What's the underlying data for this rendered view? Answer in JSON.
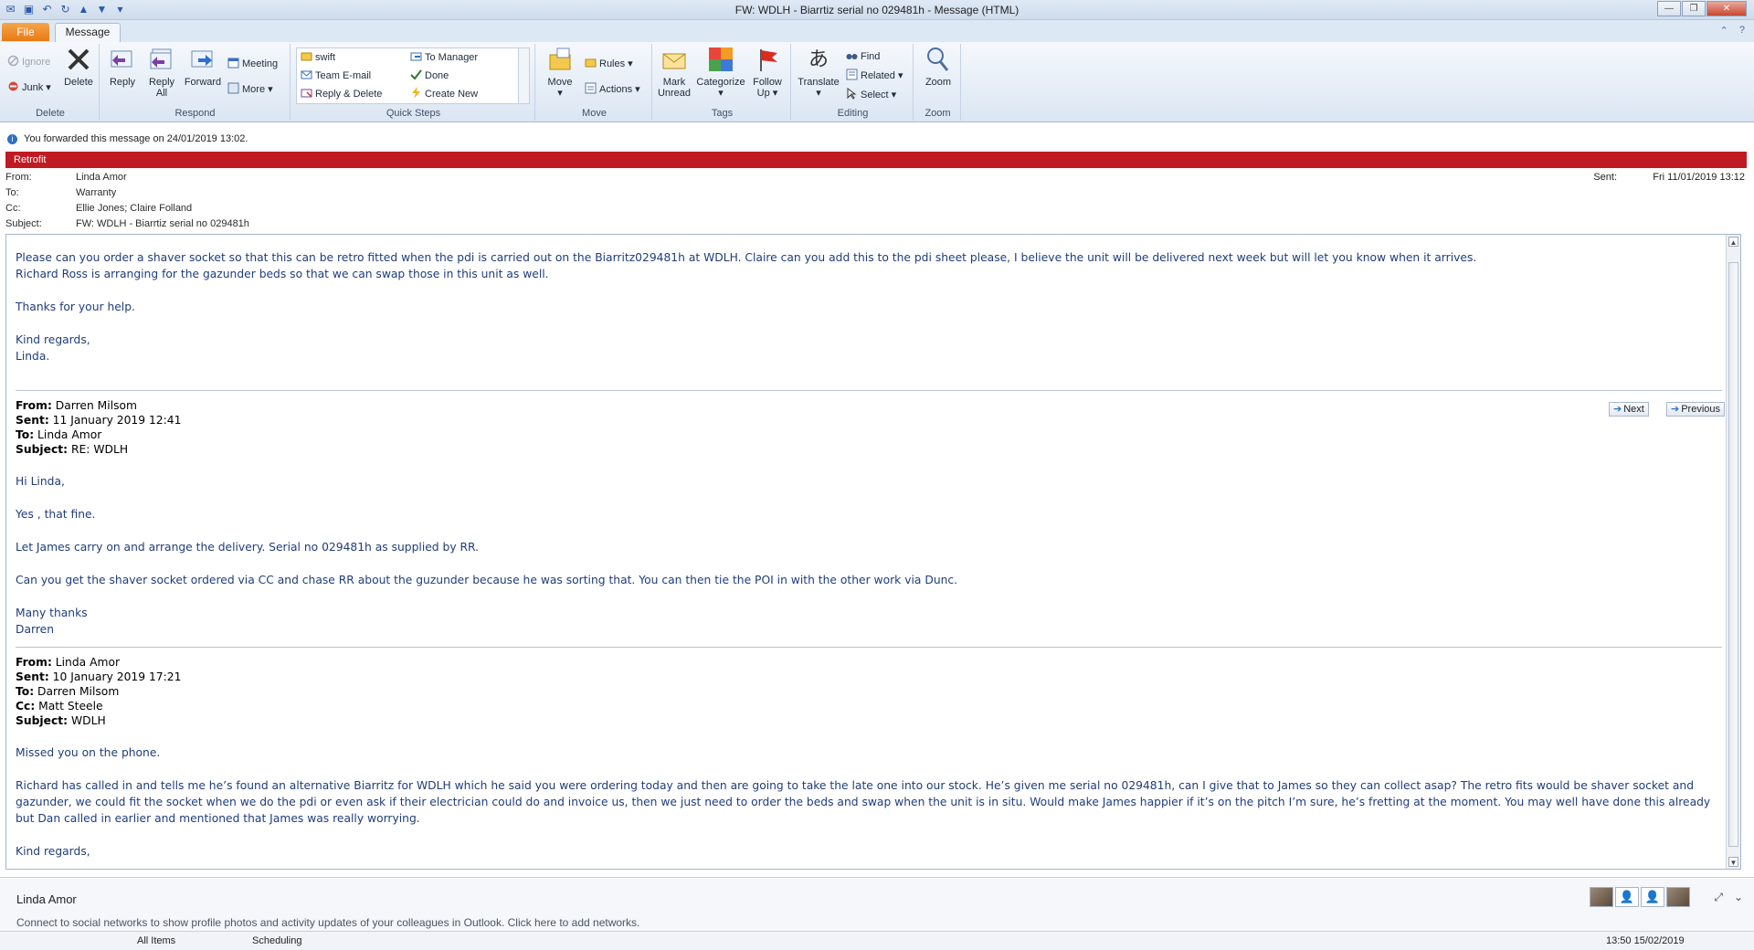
{
  "window": {
    "title": "FW: WDLH - Biarrtiz serial no 029481h  -  Message (HTML)"
  },
  "ribbon_tabs": {
    "file": "File",
    "message": "Message"
  },
  "ribbon": {
    "delete_group": {
      "label": "Delete",
      "ignore": "Ignore",
      "junk": "Junk",
      "delete": "Delete"
    },
    "respond_group": {
      "label": "Respond",
      "reply": "Reply",
      "reply_all_1": "Reply",
      "reply_all_2": "All",
      "forward": "Forward",
      "meeting": "Meeting",
      "more": "More"
    },
    "quick_steps_group": {
      "label": "Quick Steps",
      "items": [
        "swift",
        "Team E-mail",
        "Reply & Delete",
        "To Manager",
        "Done",
        "Create New"
      ]
    },
    "move_group": {
      "label": "Move",
      "move": "Move",
      "rules": "Rules",
      "actions": "Actions"
    },
    "tags_group": {
      "label": "Tags",
      "mark_unread_1": "Mark",
      "mark_unread_2": "Unread",
      "categorize": "Categorize",
      "follow_up_1": "Follow",
      "follow_up_2": "Up"
    },
    "editing_group": {
      "label": "Editing",
      "translate": "Translate",
      "find": "Find",
      "related": "Related",
      "select": "Select"
    },
    "zoom_group": {
      "label": "Zoom",
      "zoom": "Zoom"
    }
  },
  "info_bar": {
    "text": "You forwarded this message on 24/01/2019 13:02."
  },
  "category": {
    "label": "Retrofit",
    "color": "#c01a22"
  },
  "header": {
    "from_label": "From:",
    "from": "Linda Amor",
    "to_label": "To:",
    "to": "Warranty",
    "cc_label": "Cc:",
    "cc": "Ellie Jones; Claire Folland",
    "subject_label": "Subject:",
    "subject": "FW: WDLH - Biarrtiz serial no 029481h",
    "sent_label": "Sent:",
    "sent": "Fri 11/01/2019 13:12"
  },
  "body": {
    "para1_line1": "Please can you order a shaver socket so that this can be retro fitted when the pdi is carried out on the Biarritz029481h  at WDLH.  Claire can you add this to the pdi sheet please, I believe the unit will be delivered next week but will let you know when it arrives.",
    "para1_line2": "Richard Ross is arranging for the gazunder beds so that we can swap those in this unit as well.",
    "thanks": "Thanks for your help.",
    "regards": "Kind regards,",
    "signoff": "Linda.",
    "nav_next": "Next",
    "nav_prev": "Previous",
    "msg2": {
      "from_label": "From:",
      "from": "Darren Milsom",
      "sent_label": "Sent:",
      "sent": "11 January 2019 12:41",
      "to_label": "To:",
      "to": "Linda Amor",
      "subject_label": "Subject:",
      "subject": "RE: WDLH",
      "greeting": "Hi Linda,",
      "line1": "Yes , that fine.",
      "line2": "Let James carry on and arrange the delivery. Serial no 029481h as supplied by RR.",
      "line3": "Can you get the shaver socket ordered via CC and chase RR about the guzunder because he was sorting that. You can then tie the POI in with the other work via Dunc.",
      "closing": "Many thanks",
      "name": "Darren"
    },
    "msg3": {
      "from_label": "From:",
      "from": "Linda Amor",
      "sent_label": "Sent:",
      "sent": "10 January 2019 17:21",
      "to_label": "To:",
      "to": "Darren Milsom",
      "cc_label": "Cc:",
      "cc": "Matt Steele",
      "subject_label": "Subject:",
      "subject": "WDLH",
      "line1": "Missed you on the phone.",
      "line2": "Richard has called in and tells me he’s found an alternative Biarritz for WDLH which he said you were ordering today and then are going to take the late one into our stock.  He’s given me serial no 029481h, can I give that to James so they can collect asap?  The retro fits would be shaver socket and gazunder, we could fit the socket when we do the pdi or even ask if their electrician could do and invoice us, then we just need to order the beds and swap when the unit is in situ.  Would make James happier if it’s on the pitch I’m sure, he’s fretting at the moment.  You may well have done this already but Dan called in earlier and mentioned that James was really worrying.",
      "closing": "Kind regards,"
    }
  },
  "people_pane": {
    "name": "Linda Amor",
    "social_text": "Connect to social networks to show profile photos and activity updates of your colleagues in Outlook. Click here to add networks."
  },
  "status_bar": {
    "all_items": "All Items",
    "scheduling": "Scheduling",
    "datetime": "13:50  15/02/2019"
  }
}
